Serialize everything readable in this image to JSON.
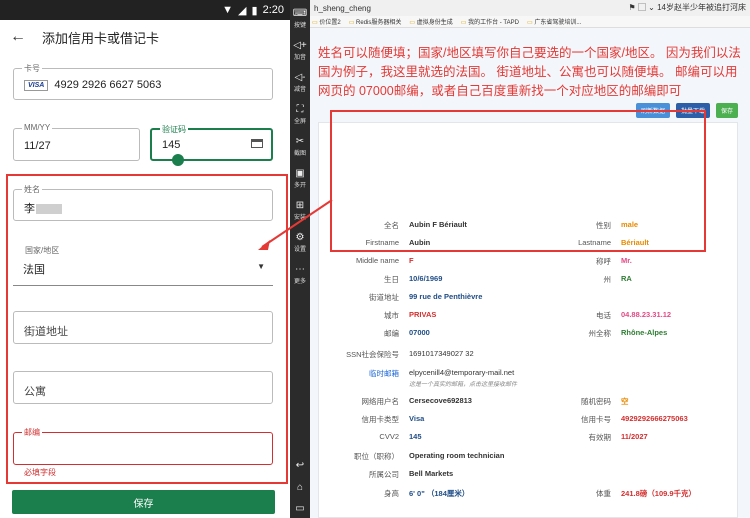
{
  "phone": {
    "status_time": "2:20",
    "app_title": "添加信用卡或借记卡",
    "card_number": {
      "label": "卡号",
      "brand": "VISA",
      "value": "4929 2926 6627 5063"
    },
    "expiry": {
      "label": "MM/YY",
      "value": "11/27"
    },
    "cvv": {
      "label": "验证码",
      "value": "145"
    },
    "name": {
      "label": "姓名",
      "value": "李"
    },
    "country": {
      "label": "国家/地区",
      "value": "法国"
    },
    "street": {
      "placeholder": "街道地址"
    },
    "apartment": {
      "placeholder": "公寓"
    },
    "postal": {
      "label": "邮编",
      "error": "必填字段"
    },
    "save": "保存"
  },
  "emulator_sidebar": [
    {
      "icon": "keyboard-icon",
      "label": "按键"
    },
    {
      "icon": "volume-up-icon",
      "label": "加音"
    },
    {
      "icon": "volume-down-icon",
      "label": "减音"
    },
    {
      "icon": "fullscreen-icon",
      "label": "全屏"
    },
    {
      "icon": "scissors-icon",
      "label": "截图"
    },
    {
      "icon": "multi-instance-icon",
      "label": "多开"
    },
    {
      "icon": "install-icon",
      "label": "安装"
    },
    {
      "icon": "settings-icon",
      "label": "设置"
    },
    {
      "icon": "more-icon",
      "label": "更多"
    }
  ],
  "emulator_nav": [
    "back-icon",
    "home-icon",
    "recents-icon"
  ],
  "browser": {
    "tab_title": "h_sheng_cheng",
    "tab_right": "14岁赵半少年被追打河床",
    "bookmarks": [
      "价位置2",
      "Redis服务器相关",
      "虚拟身份生成",
      "我的工作台 - TAPD",
      "广东省驾驶培训..."
    ],
    "annotation": "姓名可以随便填；国家/地区填写你自己要选的一个国家/地区。 因为我们以法国为例子，我这里就选的法国。  街道地址、公寓也可以随便填。  邮编可以用网页的 07000邮编，或者自己百度重新找一个对应地区的邮编即可",
    "buttons": {
      "refresh": "刷新数据",
      "batch": "批量下载",
      "save": "保存"
    },
    "fields": {
      "full_name": {
        "label": "全名",
        "value": "Aubin F Bériault"
      },
      "gender": {
        "label": "性别",
        "value": "male"
      },
      "firstname": {
        "label": "Firstname",
        "value": "Aubin"
      },
      "lastname": {
        "label": "Lastname",
        "value": "Bériault"
      },
      "middle": {
        "label": "Middle name",
        "value": "F"
      },
      "title": {
        "label": "称呼",
        "value": "Mr."
      },
      "birthday": {
        "label": "生日",
        "value": "10/6/1969"
      },
      "state": {
        "label": "州",
        "value": "RA"
      },
      "street": {
        "label": "街道地址",
        "value": "99 rue de Penthièvre"
      },
      "city": {
        "label": "城市",
        "value": "PRIVAS"
      },
      "phone": {
        "label": "电话",
        "value": "04.88.23.31.12"
      },
      "zip": {
        "label": "邮编",
        "value": "07000"
      },
      "state_full": {
        "label": "州全称",
        "value": "Rhône-Alpes"
      },
      "ssn": {
        "label": "SSN社会保险号",
        "value": "1691017349027 32"
      },
      "temp_email": {
        "label": "临时邮箱",
        "value": "elpycenill4@temporary-mail.net",
        "note": "这是一个真实的邮箱，点击这里接收邮件"
      },
      "username": {
        "label": "网络用户名",
        "value": "Cersecove692813"
      },
      "random_pw": {
        "label": "随机密码",
        "value": "空"
      },
      "card_type": {
        "label": "信用卡类型",
        "value": "Visa"
      },
      "card_number": {
        "label": "信用卡号",
        "value": "4929292666275063"
      },
      "cvv2": {
        "label": "CVV2",
        "value": "145"
      },
      "expiry": {
        "label": "有效期",
        "value": "11/2027"
      },
      "occupation": {
        "label": "职位（职称）",
        "value": "Operating room technician"
      },
      "company": {
        "label": "所属公司",
        "value": "Bell Markets"
      },
      "height": {
        "label": "身高",
        "value": "6' 0\" （184厘米）"
      },
      "weight": {
        "label": "体重",
        "value": "241.8磅（109.9千克）"
      }
    }
  }
}
